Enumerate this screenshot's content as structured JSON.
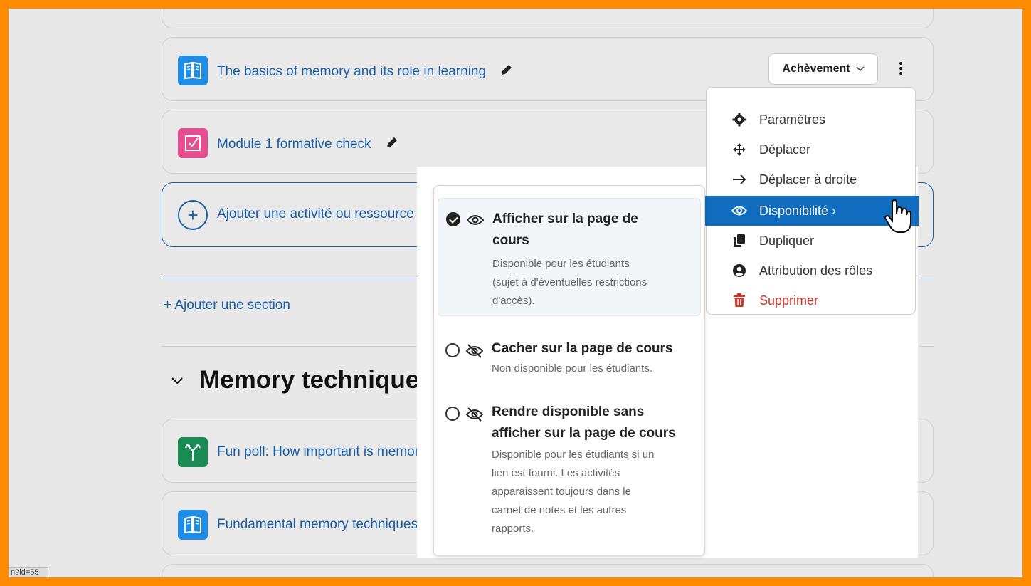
{
  "activities": [
    {
      "title": "The basics of memory and its role in learning",
      "type": "book"
    },
    {
      "title": "Module 1 formative check",
      "type": "quiz"
    }
  ],
  "completion_label": "Achèvement",
  "add_activity_label": "Ajouter une activité ou ressource",
  "add_section_label": "+ Ajouter une section",
  "section": {
    "title": "Memory techniques",
    "activities": [
      {
        "title": "Fun poll: How important is memory",
        "type": "choice"
      },
      {
        "title": "Fundamental memory techniques",
        "type": "book"
      }
    ]
  },
  "action_menu": {
    "items": [
      {
        "label": "Paramètres",
        "icon": "gear-icon"
      },
      {
        "label": "Déplacer",
        "icon": "move-icon"
      },
      {
        "label": "Déplacer à droite",
        "icon": "arrow-right-icon"
      },
      {
        "label": "Disponibilité ›",
        "icon": "eye-icon",
        "active": true
      },
      {
        "label": "Dupliquer",
        "icon": "copy-icon"
      },
      {
        "label": "Attribution des rôles",
        "icon": "user-circle-icon"
      },
      {
        "label": "Supprimer",
        "icon": "trash-icon",
        "danger": true
      }
    ]
  },
  "availability": {
    "options": [
      {
        "title_line1": "Afficher sur la page de",
        "title_line2": "cours",
        "desc": [
          "Disponible pour les étudiants",
          "(sujet à d'éventuelles restrictions",
          "d'accès)."
        ],
        "selected": true
      },
      {
        "title_line1": "Cacher sur la page de cours",
        "desc": [
          "Non disponible pour les étudiants."
        ],
        "selected": false
      },
      {
        "title_line1": "Rendre disponible sans",
        "title_line2": "afficher sur la page de cours",
        "desc": [
          "Disponible pour les étudiants si un",
          "lien est fourni. Les activités",
          "apparaissent toujours dans le",
          "carnet de notes et les autres",
          "rapports."
        ],
        "selected": false
      }
    ]
  },
  "status_url": "n?id=55",
  "colors": {
    "accent": "#0f6cbf",
    "frame": "#ff8c00",
    "danger": "#c8342a"
  }
}
